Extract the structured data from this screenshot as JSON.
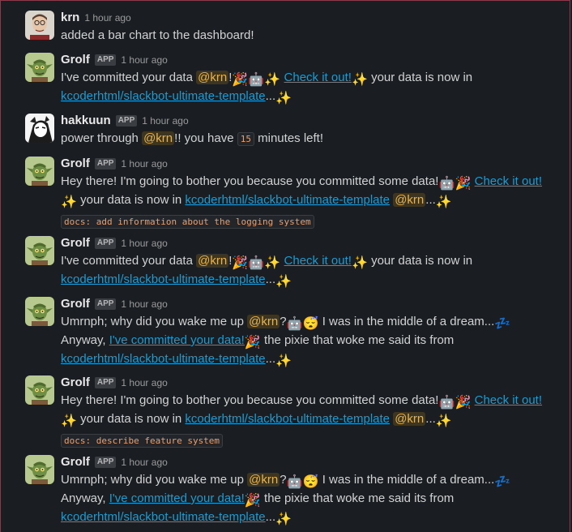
{
  "messages": [
    {
      "id": "m1",
      "user": "krn",
      "app": false,
      "time": "1 hour ago",
      "avatar": "person-avatar",
      "text": "added a bar chart to the dashboard!"
    },
    {
      "id": "m2",
      "user": "Grolf",
      "app": true,
      "time": "1 hour ago",
      "avatar": "goblin-avatar",
      "p1": "I've committed your data",
      "mention": "@krn",
      "p2": "!",
      "link": "Check it out!",
      "p3": "your data is now in",
      "repo": "kcoderhtml/slackbot-ultimate-template",
      "p4": "..."
    },
    {
      "id": "m3",
      "user": "hakkuun",
      "app": true,
      "time": "1 hour ago",
      "avatar": "anime-avatar",
      "p1": "power through",
      "mention": "@krn",
      "p2": "!! you have",
      "minutes": "15",
      "p3": "minutes left!"
    },
    {
      "id": "m4",
      "user": "Grolf",
      "app": true,
      "time": "1 hour ago",
      "avatar": "goblin-avatar",
      "p1": "Hey there! I'm going to bother you because you committed some data!",
      "link": "Check it out!",
      "p2": "your data is now in",
      "repo": "kcoderhtml/slackbot-ultimate-template",
      "mention": "@krn",
      "p3": "...",
      "code": "docs: add information about the logging system"
    },
    {
      "id": "m5",
      "user": "Grolf",
      "app": true,
      "time": "1 hour ago",
      "avatar": "goblin-avatar",
      "p1": "I've committed your data",
      "mention": "@krn",
      "p2": "!",
      "link": "Check it out!",
      "p3": "your data is now in",
      "repo": "kcoderhtml/slackbot-ultimate-template",
      "p4": "..."
    },
    {
      "id": "m6",
      "user": "Grolf",
      "app": true,
      "time": "1 hour ago",
      "avatar": "goblin-avatar",
      "p1": "Umrnph; why did you wake me up",
      "mention": "@krn",
      "p2": "?",
      "p3": "I was in the middle of a dream...",
      "p4": "Anyway,",
      "link": "I've committed your data!",
      "p5": "the pixie that woke me said its from",
      "repo": "kcoderhtml/slackbot-ultimate-template",
      "p6": "..."
    },
    {
      "id": "m7",
      "user": "Grolf",
      "app": true,
      "time": "1 hour ago",
      "avatar": "goblin-avatar",
      "p1": "Hey there! I'm going to bother you because you committed some data!",
      "link": "Check it out!",
      "p2": "your data is now in",
      "repo": "kcoderhtml/slackbot-ultimate-template",
      "mention": "@krn",
      "p3": "...",
      "code": "docs: describe feature system"
    },
    {
      "id": "m8",
      "user": "Grolf",
      "app": true,
      "time": "1 hour ago",
      "avatar": "goblin-avatar",
      "p1": "Umrnph; why did you wake me up",
      "mention": "@krn",
      "p2": "?",
      "p3": "I was in the middle of a dream...",
      "p4": "Anyway,",
      "link": "I've committed your data!",
      "p5": "the pixie that woke me said its from",
      "repo": "kcoderhtml/slackbot-ultimate-template",
      "p6": "..."
    }
  ],
  "app_badge": "APP",
  "emojis": {
    "tada": "🎉",
    "robot": "🤖",
    "sparkles": "✨",
    "sleepy": "😴",
    "zzz": "💤"
  },
  "colors": {
    "background": "#1a1d21",
    "link": "#1d9bd1",
    "mention": "#e8b34b",
    "code": "#e8a072"
  }
}
